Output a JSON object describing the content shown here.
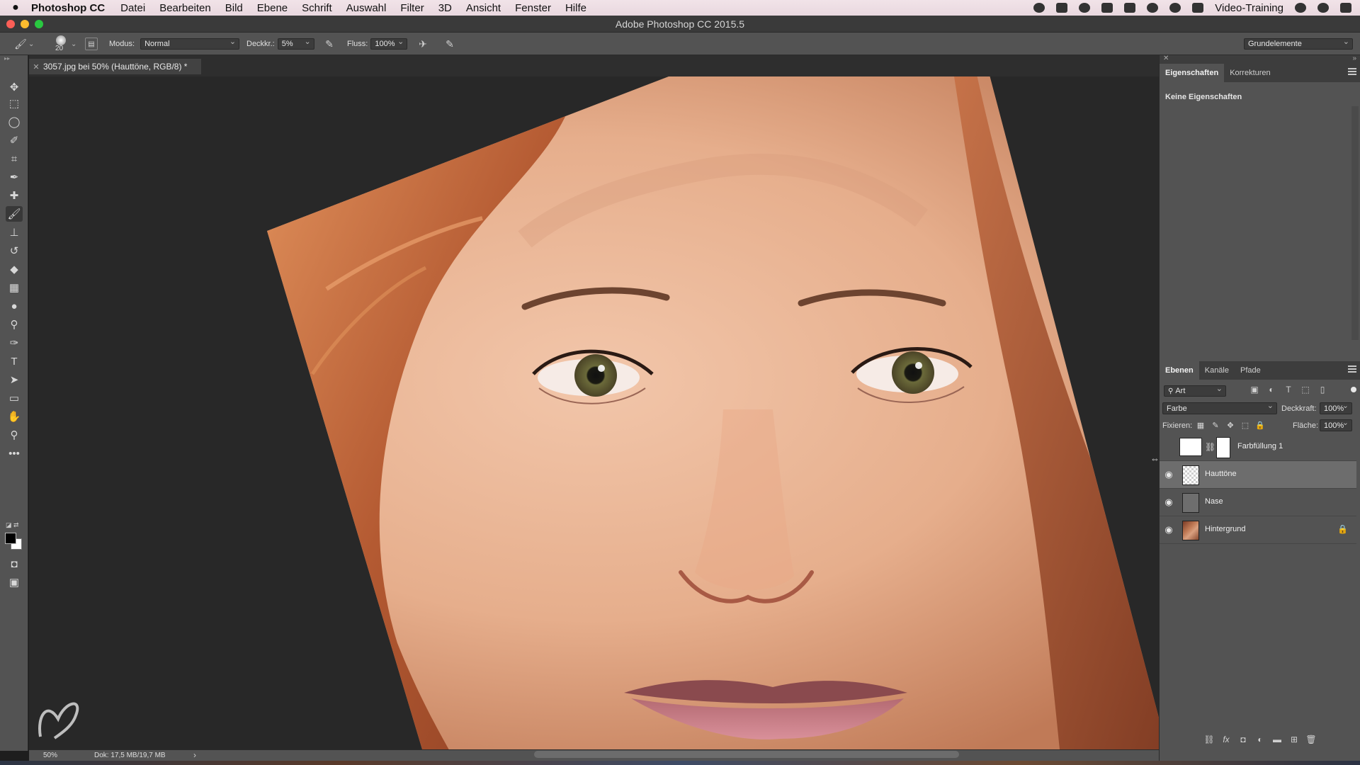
{
  "menubar": {
    "app_name": "Photoshop CC",
    "menus": [
      "Datei",
      "Bearbeiten",
      "Bild",
      "Ebene",
      "Schrift",
      "Auswahl",
      "Filter",
      "3D",
      "Ansicht",
      "Fenster",
      "Hilfe"
    ],
    "user": "Video-Training"
  },
  "window": {
    "title": "Adobe Photoshop CC 2015.5"
  },
  "options_bar": {
    "brush_size": "20",
    "mode_label": "Modus:",
    "mode_value": "Normal",
    "opacity_label": "Deckkr.:",
    "opacity_value": "5%",
    "flow_label": "Fluss:",
    "flow_value": "100%",
    "workspace": "Grundelemente"
  },
  "document": {
    "tab_title": "3057.jpg bei 50% (Hauttöne, RGB/8) *",
    "zoom": "50%",
    "doc_size": "Dok: 17,5 MB/19,7 MB"
  },
  "properties_panel": {
    "tabs": [
      "Eigenschaften",
      "Korrekturen"
    ],
    "empty_text": "Keine Eigenschaften"
  },
  "layers_panel": {
    "tabs": [
      "Ebenen",
      "Kanäle",
      "Pfade"
    ],
    "filter_kind": "Art",
    "blend_mode": "Farbe",
    "opacity_label": "Deckkraft:",
    "opacity_value": "100%",
    "lock_label": "Fixieren:",
    "fill_label": "Fläche:",
    "fill_value": "100%",
    "layers": [
      {
        "name": "Farbfüllung 1",
        "visible": false,
        "selected": false
      },
      {
        "name": "Hauttöne",
        "visible": true,
        "selected": true
      },
      {
        "name": "Nase",
        "visible": true,
        "selected": false
      },
      {
        "name": "Hintergrund",
        "visible": true,
        "selected": false,
        "locked": true
      }
    ]
  }
}
